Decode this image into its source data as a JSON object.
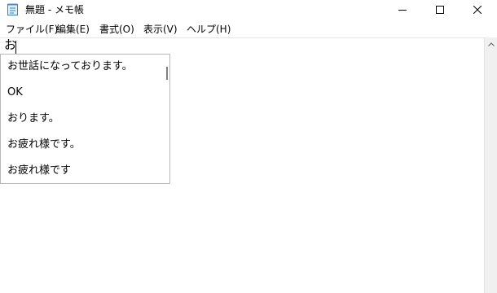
{
  "window": {
    "title": "無題 - メモ帳"
  },
  "menu": [
    {
      "label": "ファイル(F)"
    },
    {
      "label": "編集(E)"
    },
    {
      "label": "書式(O)"
    },
    {
      "label": "表示(V)"
    },
    {
      "label": "ヘルプ(H)"
    }
  ],
  "editor": {
    "text": "お"
  },
  "ime": {
    "candidates": [
      "お世話になっております。",
      "OK",
      "おります。",
      "お疲れ様です。",
      "お疲れ様です"
    ]
  },
  "icons": {
    "app": "notepad-icon",
    "minimize": "minimize-icon",
    "maximize": "maximize-icon",
    "close": "close-icon",
    "scroll_up": "scroll-up-arrow-icon"
  }
}
